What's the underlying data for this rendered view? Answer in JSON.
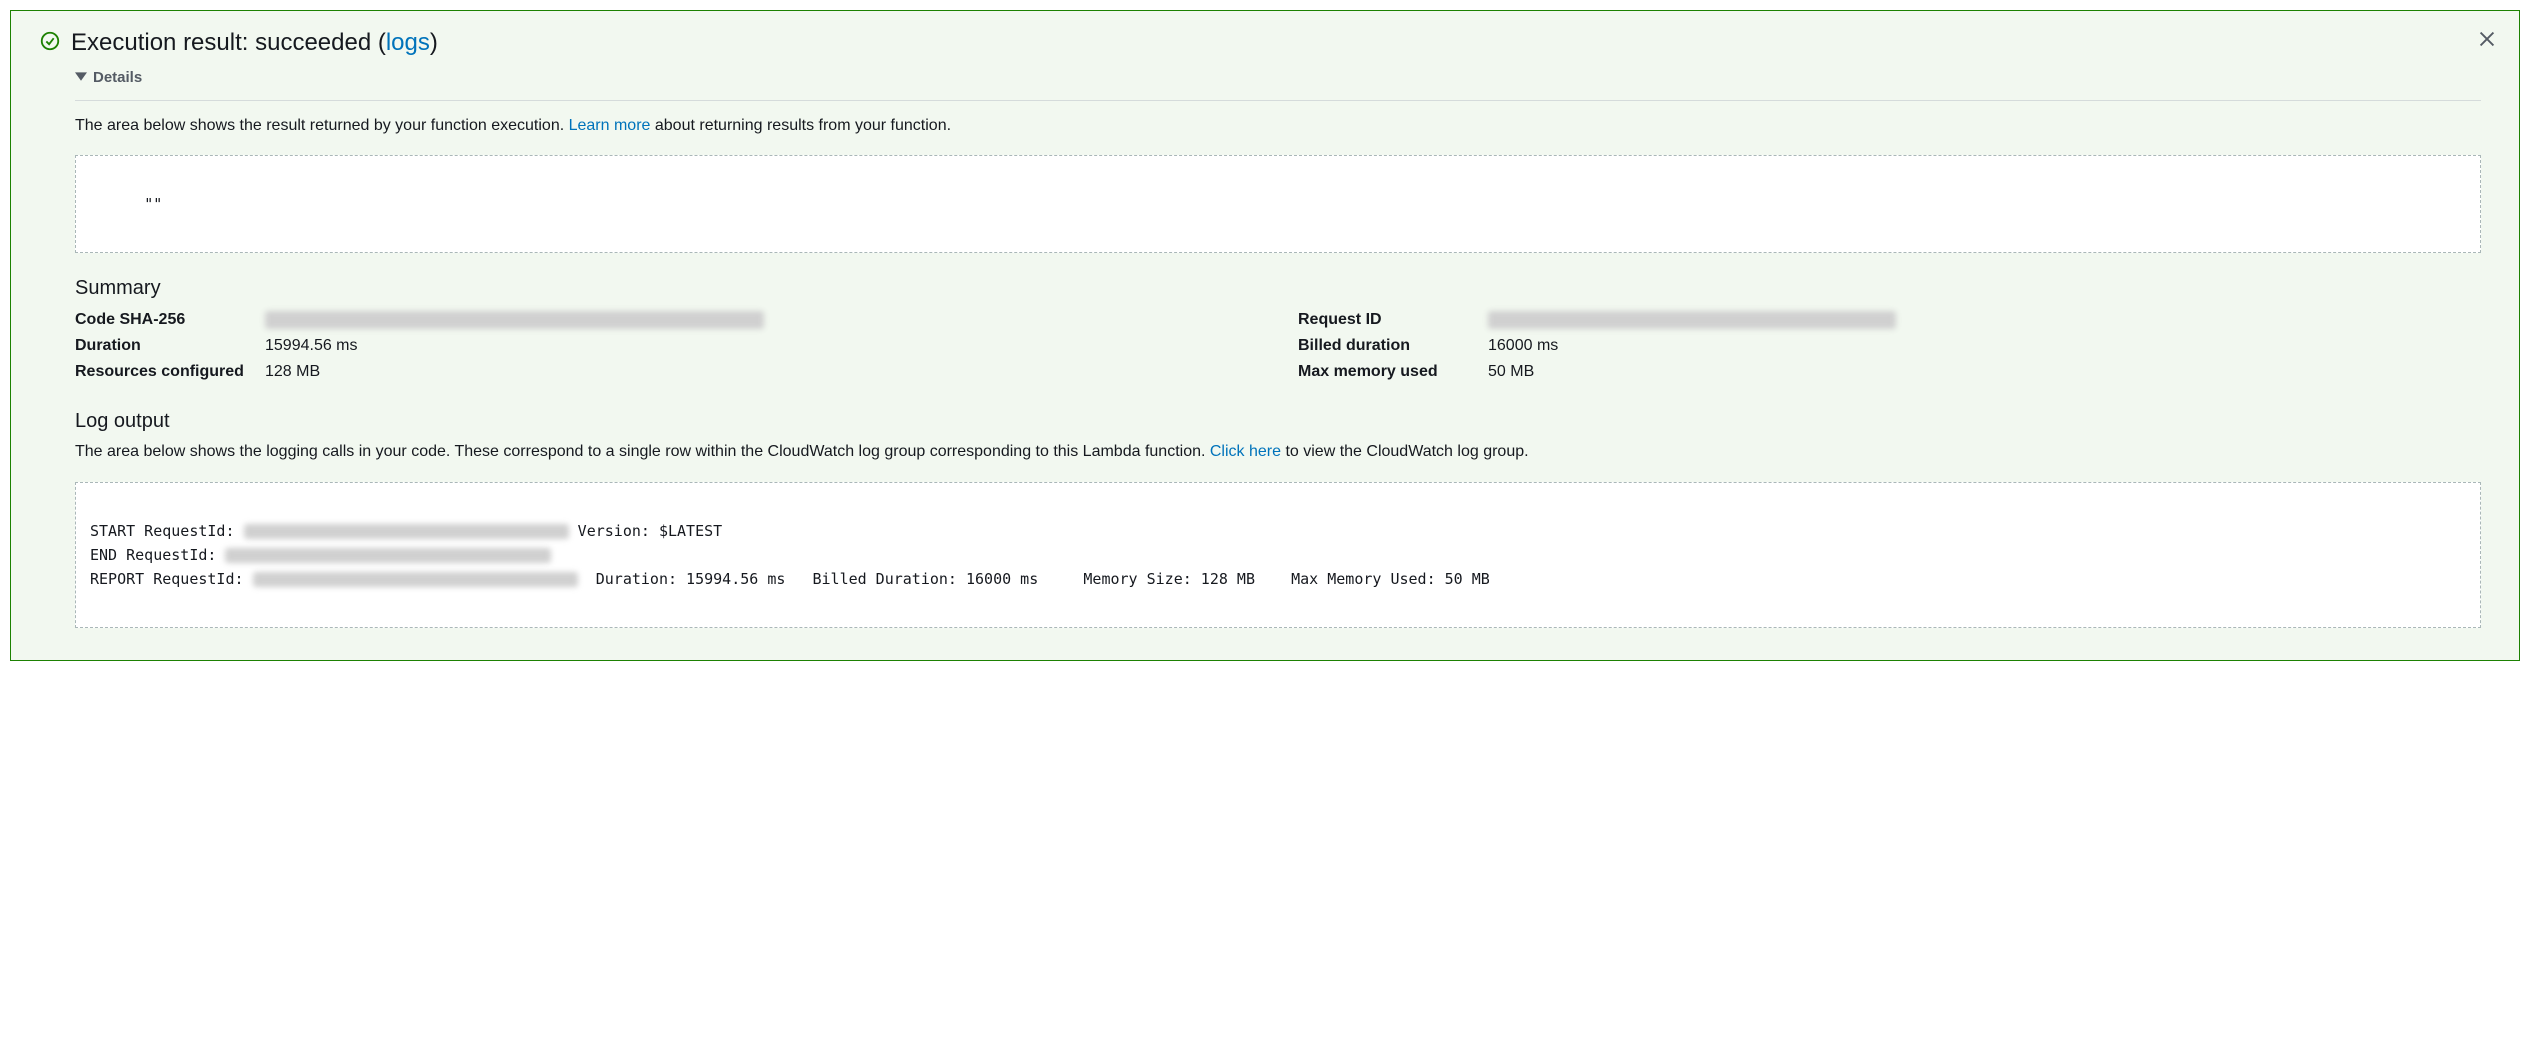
{
  "header": {
    "prefix": "Execution result: succeeded (",
    "logs_link": "logs",
    "suffix": ")"
  },
  "details_label": "Details",
  "result_area": {
    "desc_before": "The area below shows the result returned by your function execution. ",
    "learn_more": "Learn more",
    "desc_after": " about returning results from your function.",
    "result_value": "\"\""
  },
  "summary": {
    "title": "Summary",
    "left": [
      {
        "label": "Code SHA-256",
        "value": "████████████████████████████████████████████"
      },
      {
        "label": "Duration",
        "value": "15994.56 ms"
      },
      {
        "label": "Resources configured",
        "value": "128 MB"
      }
    ],
    "right": [
      {
        "label": "Request ID",
        "value": "████████████████████████████████████"
      },
      {
        "label": "Billed duration",
        "value": "16000 ms"
      },
      {
        "label": "Max memory used",
        "value": "50 MB"
      }
    ]
  },
  "log_output": {
    "title": "Log output",
    "desc_before": "The area below shows the logging calls in your code. These correspond to a single row within the CloudWatch log group corresponding to this Lambda function. ",
    "click_here": "Click here",
    "desc_after": " to view the CloudWatch log group.",
    "lines": {
      "start_prefix": "START RequestId: ",
      "start_suffix": " Version: $LATEST",
      "end_prefix": "END RequestId: ",
      "report_prefix": "REPORT RequestId: ",
      "report_tail": "  Duration: 15994.56 ms   Billed Duration: 16000 ms     Memory Size: 128 MB    Max Memory Used: 50 MB"
    }
  }
}
